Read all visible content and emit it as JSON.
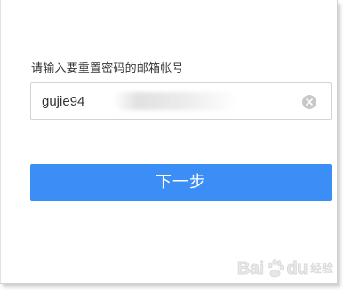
{
  "form": {
    "prompt": "请输入要重置密码的邮箱帐号",
    "email_value": "gujie94",
    "clear_icon": "clear-circle-icon",
    "next_label": "下一步"
  },
  "colors": {
    "accent": "#3b8ef5",
    "input_border": "#d3d3d3",
    "text": "#333333"
  },
  "watermark": {
    "brand": "Bai",
    "brand_end": "du",
    "sub": "经验",
    "paw_icon": "baidu-paw-icon"
  }
}
